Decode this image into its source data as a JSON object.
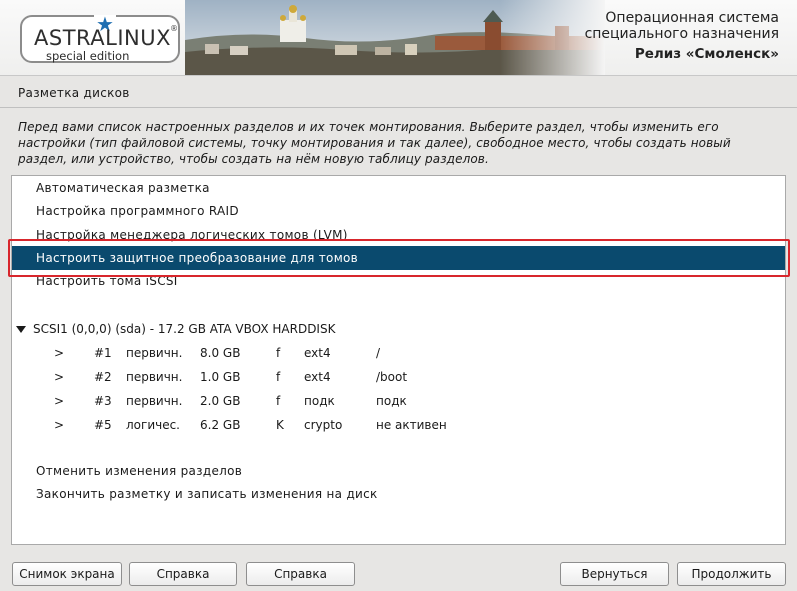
{
  "header": {
    "logo_title": "ASTRALINUX",
    "logo_reg": "®",
    "logo_subtitle": "special edition",
    "os_line1": "Операционная система",
    "os_line2": "специального назначения",
    "release": "Релиз «Смоленск»"
  },
  "step": {
    "title": "Разметка дисков",
    "description": "Перед вами список настроенных разделов и их точек монтирования. Выберите раздел, чтобы изменить его настройки (тип файловой системы, точку монтирования и так далее), свободное место, чтобы создать новый раздел, или устройство, чтобы создать на нём новую таблицу разделов."
  },
  "menu": {
    "items": [
      "Автоматическая разметка",
      "Настройка программного RAID",
      "Настройка менеджера логических томов (LVM)",
      "Настроить защитное преобразование для томов",
      "Настроить тома iSCSI"
    ],
    "selected_index": 3
  },
  "disk": {
    "label": "SCSI1 (0,0,0) (sda) - 17.2 GB ATA VBOX HARDDISK",
    "partitions": [
      {
        "arrow": ">",
        "num": "#1",
        "type": "первичн.",
        "size": "8.0 GB",
        "flag": "f",
        "fs": "ext4",
        "mount": "/"
      },
      {
        "arrow": ">",
        "num": "#2",
        "type": "первичн.",
        "size": "1.0 GB",
        "flag": "f",
        "fs": "ext4",
        "mount": "/boot"
      },
      {
        "arrow": ">",
        "num": "#3",
        "type": "первичн.",
        "size": "2.0 GB",
        "flag": "f",
        "fs": "подк",
        "mount": "подк"
      },
      {
        "arrow": ">",
        "num": "#5",
        "type": "логичес.",
        "size": "6.2 GB",
        "flag": "K",
        "fs": "crypto",
        "mount": "не активен"
      }
    ]
  },
  "actions": {
    "undo": "Отменить изменения разделов",
    "finish": "Закончить разметку и записать изменения на диск"
  },
  "buttons": {
    "screenshot": "Снимок экрана",
    "help1": "Справка",
    "help2": "Справка",
    "back": "Вернуться",
    "continue": "Продолжить"
  },
  "colors": {
    "selection": "#0a4a6e",
    "highlight_border": "#d8262c",
    "logo_star": "#1f6fb2"
  }
}
